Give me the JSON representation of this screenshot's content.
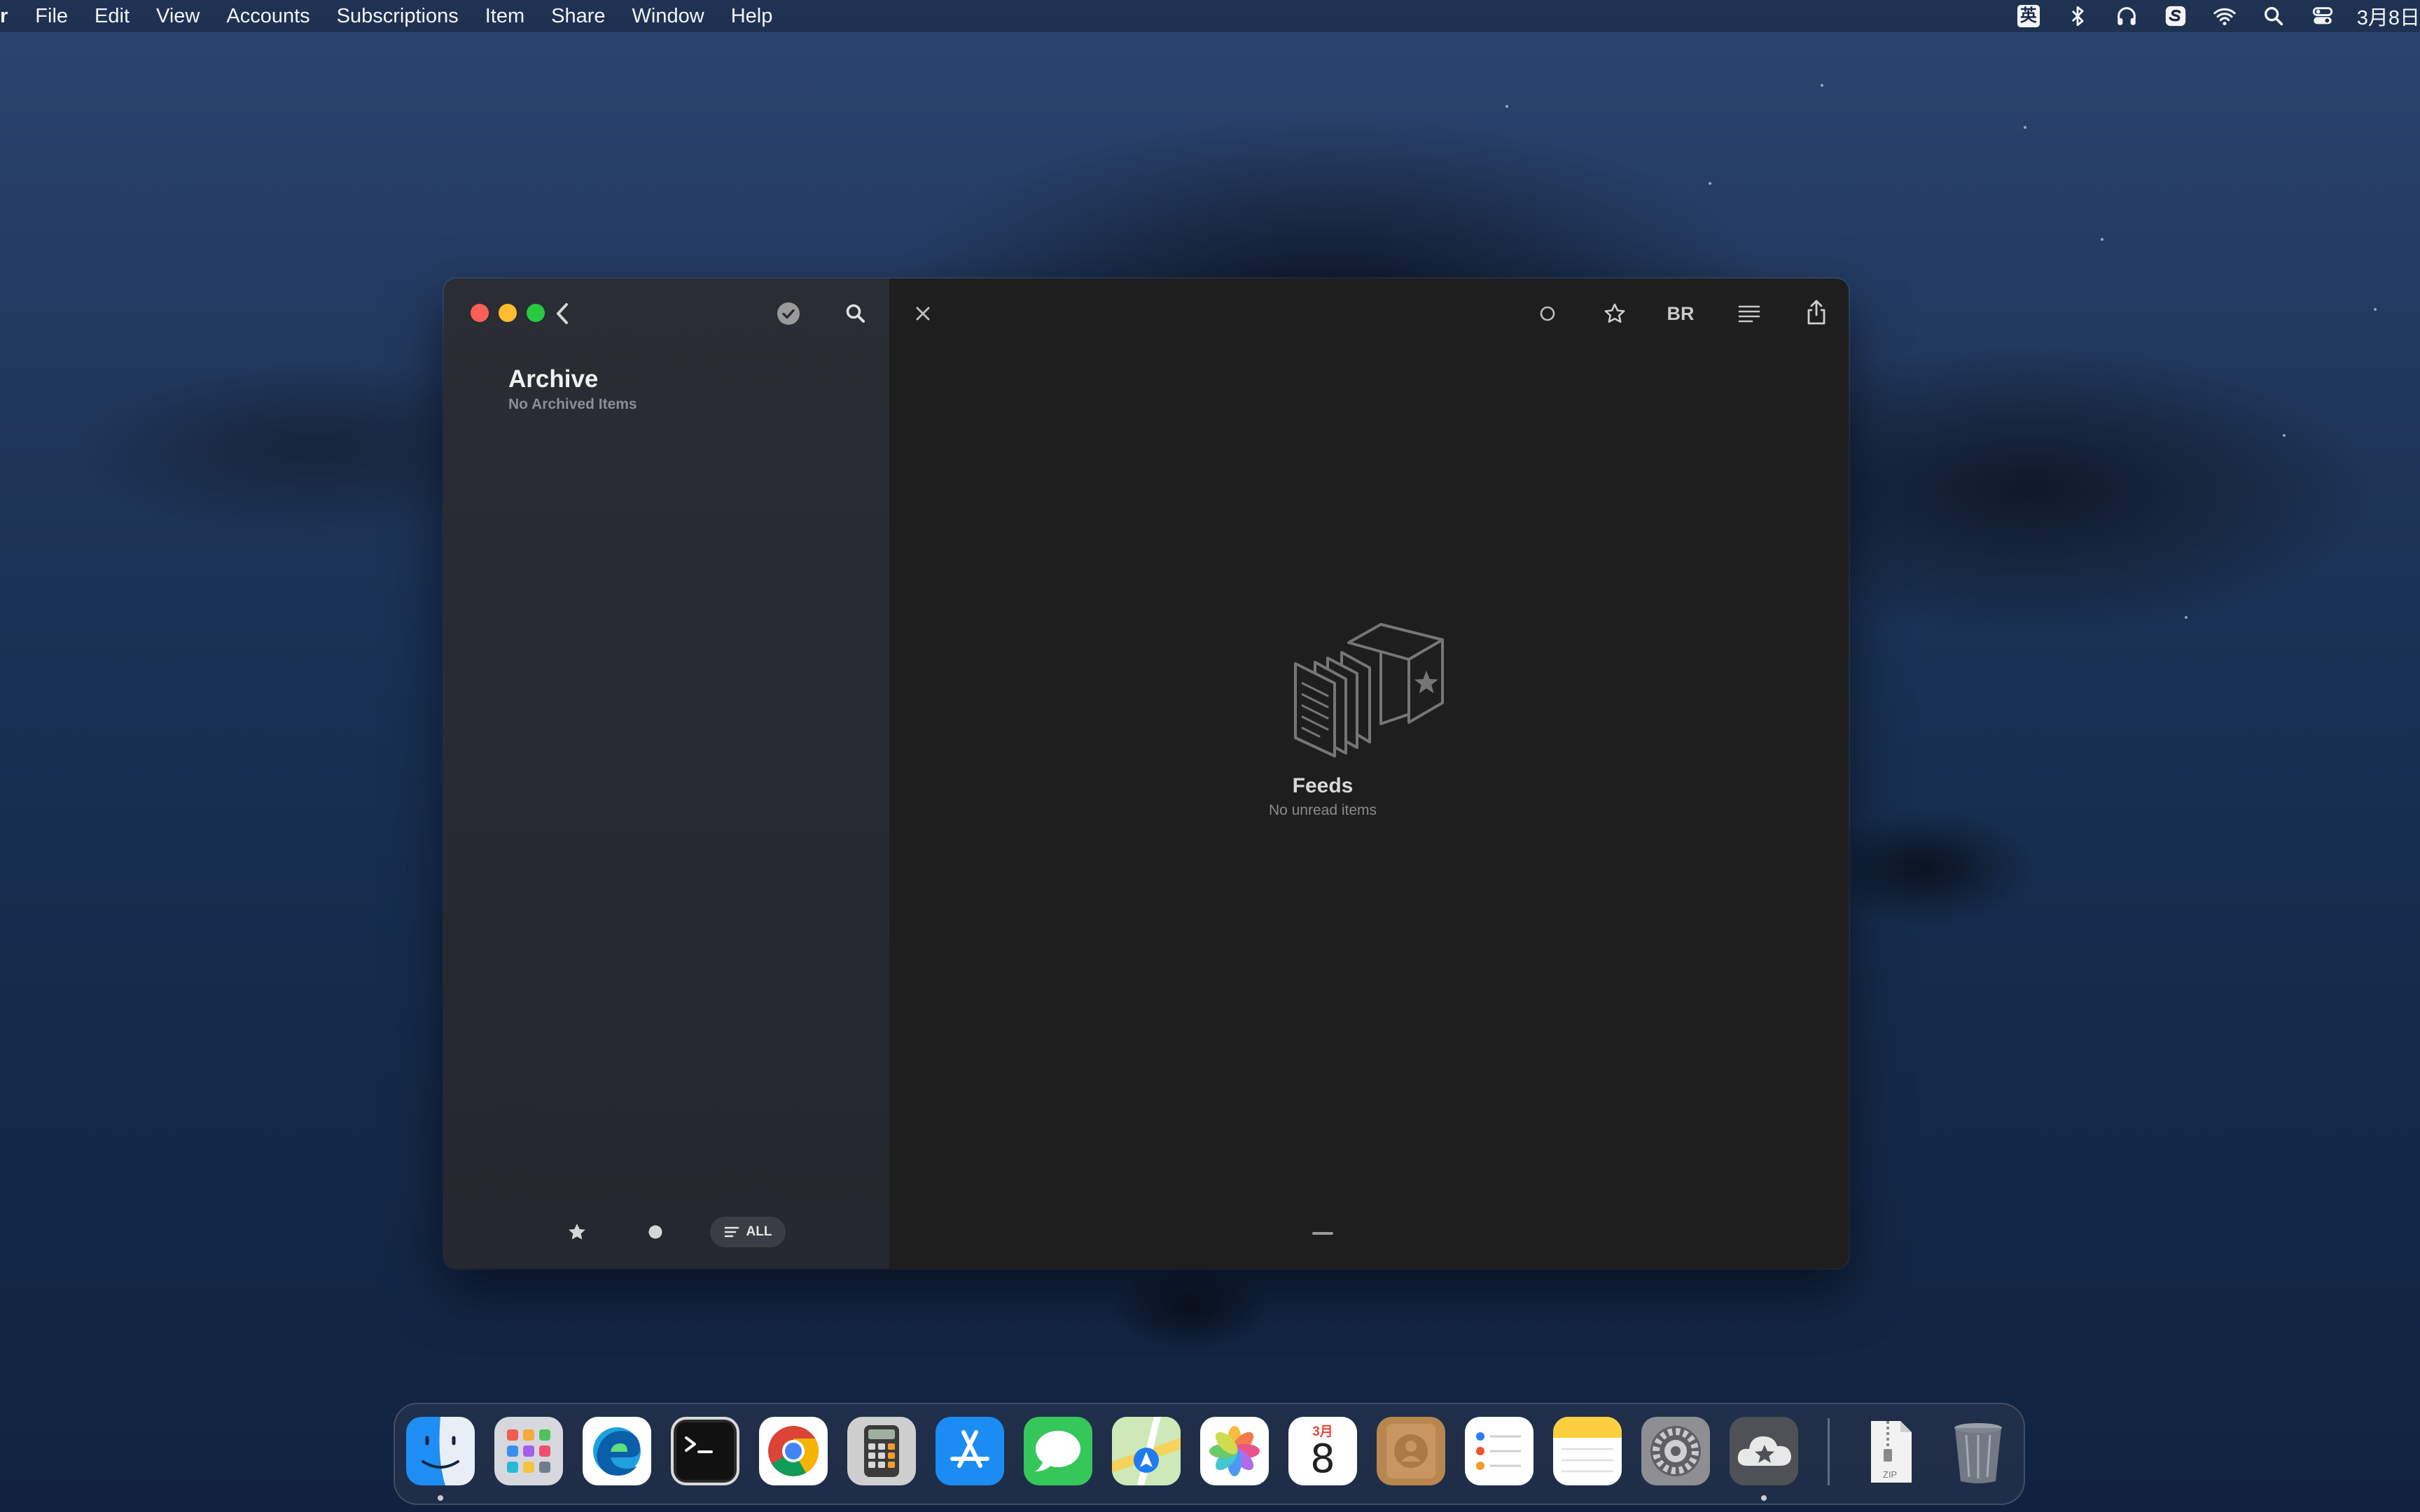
{
  "menubar": {
    "app_name": "r",
    "items": [
      {
        "label": "File"
      },
      {
        "label": "Edit"
      },
      {
        "label": "View"
      },
      {
        "label": "Accounts"
      },
      {
        "label": "Subscriptions"
      },
      {
        "label": "Item"
      },
      {
        "label": "Share"
      },
      {
        "label": "Window"
      },
      {
        "label": "Help"
      }
    ],
    "status_icons": [
      "input-method-icon",
      "bluetooth-icon",
      "headphones-icon",
      "sougou-icon",
      "wifi-icon",
      "spotlight-search-icon",
      "control-center-icon"
    ],
    "input_method_label": "英",
    "date_text": "3月8日"
  },
  "window": {
    "sidebar": {
      "title": "Archive",
      "subtitle": "No Archived Items",
      "filter_all_label": "ALL"
    },
    "content": {
      "empty_title": "Feeds",
      "empty_subtitle": "No unread items",
      "toolbar": {
        "reader_mode_label": "BR"
      }
    }
  },
  "dock": {
    "apps": [
      "Finder",
      "Launchpad",
      "Microsoft Edge",
      "Terminal",
      "Google Chrome",
      "Calculator",
      "App Store",
      "Messages",
      "Maps",
      "Photos",
      "Calendar",
      "Contacts",
      "Reminders",
      "Notes",
      "System Preferences",
      "Reeder",
      "Archive Utility",
      "Trash"
    ],
    "calendar": {
      "month": "3月",
      "day": "8"
    },
    "archive_label": "ZIP"
  },
  "colors": {
    "close": "#ff5f57",
    "minimize": "#febc2e",
    "maximize": "#28c840",
    "sidebar_bg": "#282b31",
    "content_bg": "#1e1e1e"
  }
}
